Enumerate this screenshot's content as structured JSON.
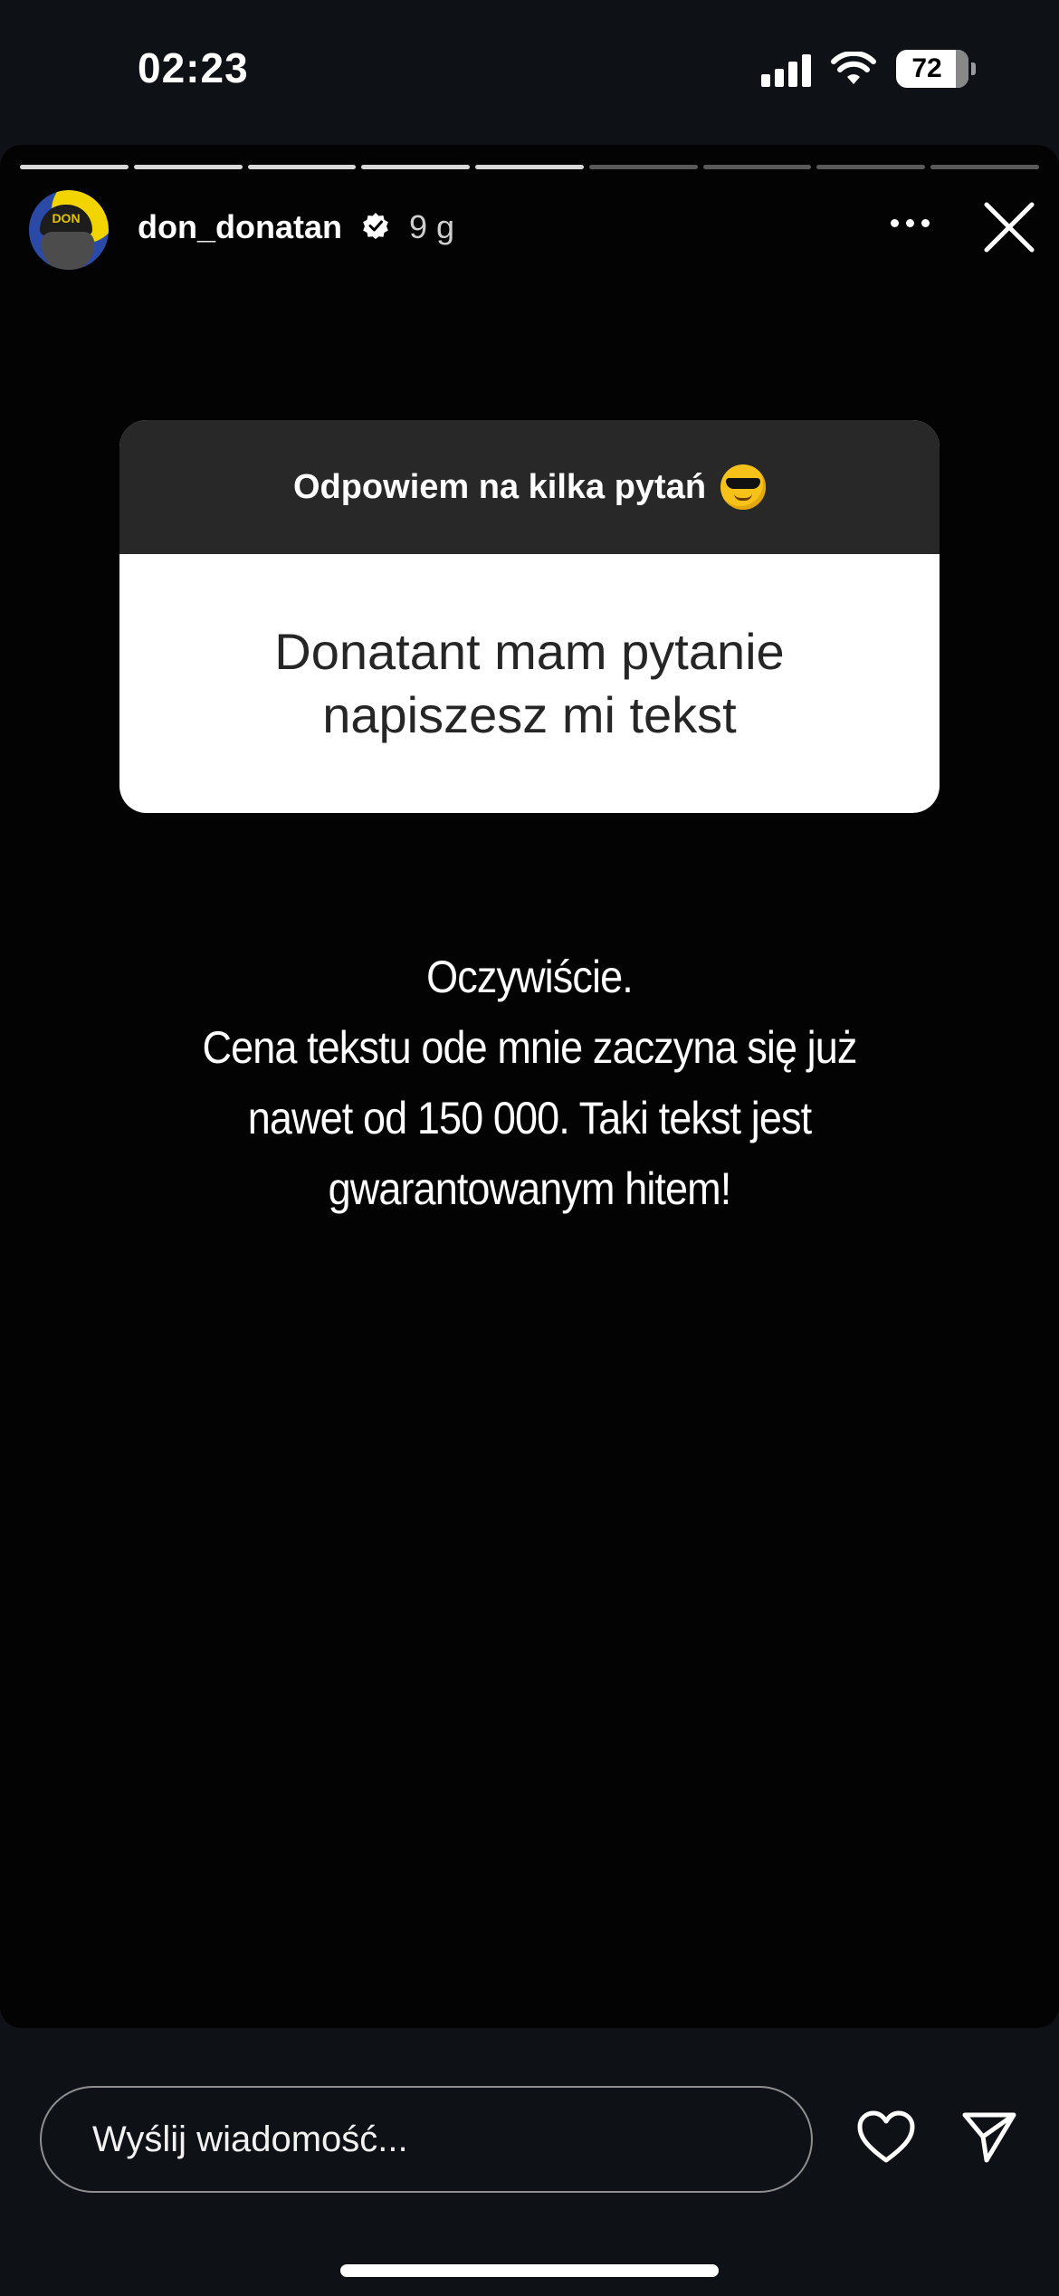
{
  "status_bar": {
    "time": "02:23",
    "battery": "72"
  },
  "story": {
    "segments_total": 9,
    "segments_viewed": 5,
    "username": "don_donatan",
    "avatar_cap_text": "DON",
    "time_ago": "9 g",
    "verified": true
  },
  "question_sticker": {
    "prompt": "Odpowiem na kilka pytań",
    "question": "Donatant mam pytanie napiszesz mi tekst"
  },
  "answer_text": "Oczywiście.\nCena tekstu ode mnie zaczyna się już\nnawet od 150  000. Taki tekst jest\ngwarantowanym hitem!",
  "reply_bar": {
    "placeholder": "Wyślij wiadomość..."
  },
  "icons": {
    "more": "more-horizontal-icon",
    "close": "close-icon",
    "like": "heart-icon",
    "share": "send-icon"
  }
}
